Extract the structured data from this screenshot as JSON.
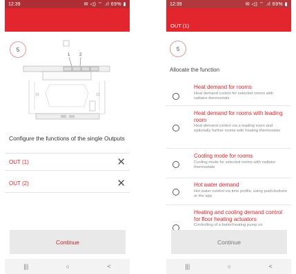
{
  "left": {
    "status": {
      "time": "12:39",
      "battery": "69%"
    },
    "step": "5",
    "callout_numbers": [
      "1",
      "2"
    ],
    "config_text": "Configure the functions of the single Outputs",
    "outputs": [
      {
        "label": "OUT (1)"
      },
      {
        "label": "OUT (2)"
      }
    ],
    "continue_label": "Continue",
    "colors": {
      "accent": "#e3262d",
      "continue_text": "#c0272d"
    }
  },
  "right": {
    "status": {
      "time": "12:39",
      "battery": "69%"
    },
    "header_title": "OUT (1)",
    "step": "5",
    "allocate_label": "Allocate the function",
    "options": [
      {
        "title": "Heat demand for rooms",
        "desc": "Heat demand control for selected rooms with radiator thermostats"
      },
      {
        "title": "Heat demand for rooms with leading room",
        "desc": "Heat demand control via a leading room and optionally further rooms with heating thermostats"
      },
      {
        "title": "Cooling mode for rooms",
        "desc": "Cooling mode for selected rooms with radiator thermostats"
      },
      {
        "title": "Hot water demand",
        "desc": "Hot water control via time profile, using push-buttons or the app"
      },
      {
        "title": "Heating and cooling demand control for floor heating actuators",
        "desc": "Controlling of a boiler/heating pump on"
      }
    ],
    "continue_label": "Continue",
    "colors": {
      "continue_text": "#777777"
    }
  },
  "nav": {
    "recents": "|||",
    "home": "○",
    "back": "<"
  },
  "icons": [
    "status-icons",
    "close-icon",
    "radio-icon",
    "recents-icon",
    "home-icon",
    "back-icon"
  ]
}
